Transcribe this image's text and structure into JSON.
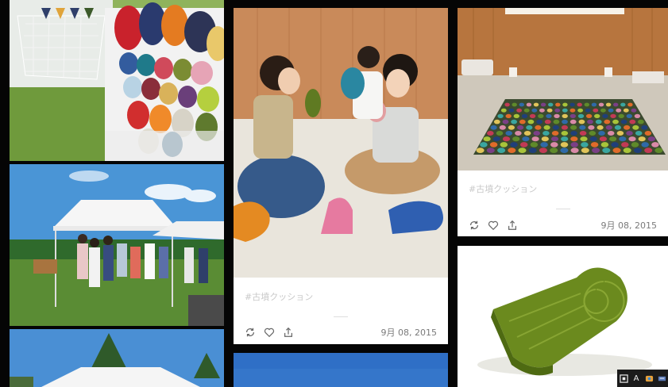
{
  "cards": [
    {
      "tag": "#古墳クッション",
      "date": "9月 08, 2015",
      "actions": [
        "repost-icon",
        "heart-icon",
        "share-icon"
      ]
    },
    {
      "tag": "#古墳クッション",
      "date": "9月 08, 2015",
      "actions": [
        "repost-icon",
        "heart-icon",
        "share-icon"
      ]
    }
  ],
  "photos": [
    {
      "name": "photo-colorful-cushions-stall"
    },
    {
      "name": "photo-outdoor-tent-market"
    },
    {
      "name": "photo-tent-sky"
    },
    {
      "name": "photo-women-with-cushions"
    },
    {
      "name": "photo-blue-sky"
    },
    {
      "name": "photo-cushion-grid-room"
    },
    {
      "name": "photo-green-keyhole-cushion"
    }
  ],
  "taskbar": {
    "ime_label": "A"
  },
  "colors": {
    "page_bg": "#050505",
    "card_bg": "#ffffff",
    "tag_text": "#c9c9c9",
    "date_text": "#7a7a7a"
  }
}
